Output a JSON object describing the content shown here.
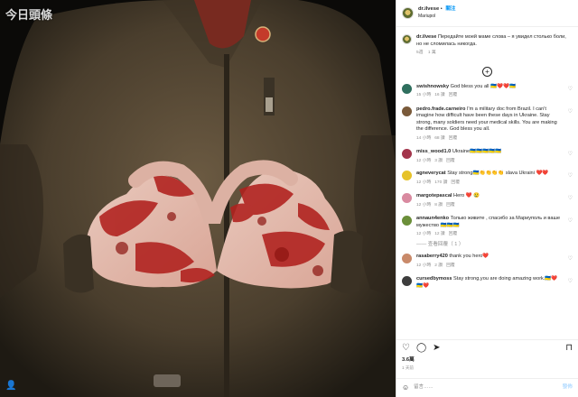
{
  "photo": {
    "watermark": "今日頭條",
    "corner_icon": "person-icon"
  },
  "header": {
    "username": "dr.ilvese",
    "follow_label": "關注",
    "location": "Mariupol"
  },
  "caption": {
    "username": "dr.ilvese",
    "text": "Передайте моей маме слова – я увидел столько боли, но не сломилась никогда.",
    "time": "5週",
    "likes": "1 萬"
  },
  "comments": [
    {
      "user": "swishnowsky",
      "text": "God bless you all 🇺🇦❤️❤️🇺🇦",
      "time": "15 小時",
      "likes": "16 讚",
      "reply": "回覆",
      "avatar_color": "#2f6f5e"
    },
    {
      "user": "pedro.frade.carneiro",
      "text": "I'm a military doc from Brazil. I can't imagine how difficult have been these days in Ukraine. Stay strong, many soldiers need your medical skills. You are making the difference. God bless you all.",
      "time": "14 小時",
      "likes": "68 讚",
      "reply": "回覆",
      "avatar_color": "#7a5a3a"
    },
    {
      "user": "miss_wood1.0",
      "text": "Ukraine🇺🇦🇺🇦🇺🇦🇺🇦🇺🇦",
      "time": "12 小時",
      "likes": "3 讚",
      "reply": "回覆",
      "avatar_color": "#a3354c"
    },
    {
      "user": "agneverycat",
      "text": "Stay strong🇺🇦👏👏👏👏 slava Ukraini ❤️❤️",
      "time": "12 小時",
      "likes": "170 讚",
      "reply": "回覆",
      "avatar_color": "#e6c229"
    },
    {
      "user": "margotepascal",
      "text": "Hero ❤️ 😢",
      "time": "12 小時",
      "likes": "8 讚",
      "reply": "回覆",
      "avatar_color": "#d98aa0"
    },
    {
      "user": "annaun4enko",
      "text": "Только живите , спасибо за Мариуполь и ваше мужество 🇺🇦🇺🇦🇺🇦",
      "time": "12 小時",
      "likes": "12 讚",
      "reply": "回覆",
      "avatar_color": "#6b8f3a"
    },
    {
      "user": "",
      "text": "—— 查看回覆（ 1 ）",
      "time": "",
      "likes": "",
      "reply": "",
      "avatar_color": ""
    },
    {
      "user": "rasaberry420",
      "text": "thank you hero❤️",
      "time": "12 小時",
      "likes": "2 讚",
      "reply": "回覆",
      "avatar_color": "#c98a6a"
    },
    {
      "user": "cursedbymoss",
      "text": "Stay strong,you are doing amazing work.🇺🇦❤️🇺🇦❤️",
      "time": "",
      "likes": "",
      "reply": "",
      "avatar_color": "#3d3d3d"
    }
  ],
  "actions": {
    "like_icon": "heart-icon",
    "comment_icon": "comment-icon",
    "share_icon": "share-icon",
    "save_icon": "bookmark-icon"
  },
  "likes_count": "3.6萬",
  "post_age": "1 天前",
  "add_comment": {
    "placeholder": "留言……",
    "post_label": "發佈"
  }
}
